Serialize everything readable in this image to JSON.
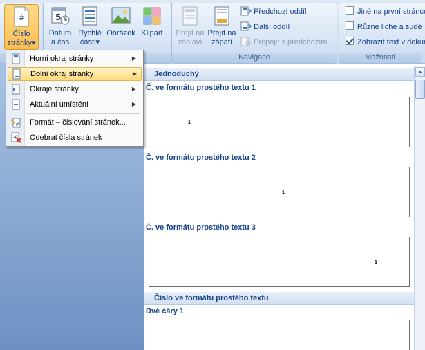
{
  "ribbon": {
    "page_number_btn": {
      "line1": "Číslo",
      "line2": "stránky",
      "dropdown": "▾"
    },
    "date_time_btn": {
      "line1": "Datum",
      "line2": "a čas"
    },
    "quick_parts_btn": {
      "line1": "Rychlé",
      "line2": "části",
      "dropdown": "▾"
    },
    "picture_btn": {
      "label": "Obrázek"
    },
    "clipart_btn": {
      "label": "Klipart"
    },
    "goto_header_btn": {
      "line1": "Přejít na",
      "line2": "záhlaví"
    },
    "goto_footer_btn": {
      "line1": "Přejít na",
      "line2": "zápatí"
    },
    "prev_section": "Předchozí oddíl",
    "next_section": "Další oddíl",
    "link_previous": "Propojit s předchozím",
    "navigation_label": "Navigace",
    "options_label": "Možnosti",
    "diff_first_page": "Jiné na první stránce",
    "diff_odd_even": "Různé liché a sudé",
    "show_doc_text": "Zobrazit text v dokumentu"
  },
  "menu": {
    "items": [
      {
        "label": "Horní okraj stránky",
        "submenu": "▶"
      },
      {
        "label": "Dolní okraj stránky",
        "submenu": "▶"
      },
      {
        "label": "Okraje stránky",
        "submenu": "▶"
      },
      {
        "label": "Aktuální umístění",
        "submenu": "▶"
      },
      {
        "label": "Formát – číslování stránek..."
      },
      {
        "label": "Odebrat čísla stránek"
      }
    ]
  },
  "gallery": {
    "category_simple": "Jednoduchý",
    "plain1": "Č. ve formátu prostého textu 1",
    "plain2": "Č. ve formátu prostého textu 2",
    "plain3": "Č. ve formátu prostého textu 3",
    "category_plain": "Číslo ve formátu prostého textu",
    "two_lines": "Dvě čáry 1",
    "sample_number": "1"
  },
  "colors": {
    "accent": "#15428b",
    "highlight": "#ffbd52"
  }
}
